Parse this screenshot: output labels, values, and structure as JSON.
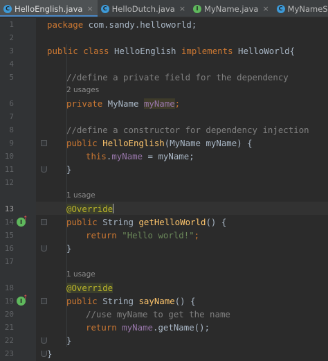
{
  "tabs": [
    {
      "label": "HelloEnglish.java",
      "icon": "class-icon",
      "letter": "C",
      "active": true
    },
    {
      "label": "HelloDutch.java",
      "icon": "class-icon",
      "letter": "C",
      "active": false
    },
    {
      "label": "MyName.java",
      "icon": "interface-icon",
      "letter": "I",
      "active": false
    },
    {
      "label": "MyNameSandy.java",
      "icon": "class-icon",
      "letter": "C",
      "active": false
    }
  ],
  "close_glyph": "×",
  "hints": {
    "h1": "2 usages",
    "h2": "1 usage",
    "h3": "1 usage"
  },
  "lines": {
    "l1": {
      "no": "1",
      "t1": "package",
      "t2": " com.sandy.helloworld;"
    },
    "l2": {
      "no": "2"
    },
    "l3": {
      "no": "3",
      "t1": "public class",
      "t2": " HelloEnglish ",
      "t3": "implements",
      "t4": " HelloWorld{"
    },
    "l4": {
      "no": "4"
    },
    "l5": {
      "no": "5",
      "t1": "//define a private field for the dependency"
    },
    "l6": {
      "no": "6",
      "t1": "private",
      "t2": " MyName ",
      "t3": "myName",
      "t4": ";"
    },
    "l7": {
      "no": "7"
    },
    "l8": {
      "no": "8",
      "t1": "//define a constructor for dependency injection"
    },
    "l9": {
      "no": "9",
      "t1": "public",
      "t2": " ",
      "t3": "HelloEnglish",
      "t4": "(MyName myName) {"
    },
    "l10": {
      "no": "10",
      "t1": "this",
      "t2": ".",
      "t3": "myName",
      "t4": " = myName;"
    },
    "l11": {
      "no": "11",
      "t1": "}"
    },
    "l12": {
      "no": "12"
    },
    "l13": {
      "no": "13",
      "t1": "@Override"
    },
    "l14": {
      "no": "14",
      "t1": "public",
      "t2": " String ",
      "t3": "getHelloWorld",
      "t4": "() {"
    },
    "l15": {
      "no": "15",
      "t1": "return",
      "t2": " ",
      "t3": "\"Hello world!\"",
      "t4": ";"
    },
    "l16": {
      "no": "16",
      "t1": "}"
    },
    "l17": {
      "no": "17"
    },
    "l18": {
      "no": "18",
      "t1": "@Override"
    },
    "l19": {
      "no": "19",
      "t1": "public",
      "t2": " String ",
      "t3": "sayName",
      "t4": "() {"
    },
    "l20": {
      "no": "20",
      "t1": "//use myName to get the name"
    },
    "l21": {
      "no": "21",
      "t1": "return",
      "t2": " ",
      "t3": "myName",
      "t4": ".getName();"
    },
    "l22": {
      "no": "22",
      "t1": "}"
    },
    "l23": {
      "no": "23",
      "t1": "}"
    }
  },
  "colors": {
    "background": "#2b2b2b",
    "keyword": "#cc7832",
    "comment": "#808080",
    "string": "#6a8759",
    "field": "#9876aa",
    "annotation": "#bbb529",
    "method": "#ffc66d",
    "tab_accent": "#4a88c7"
  }
}
